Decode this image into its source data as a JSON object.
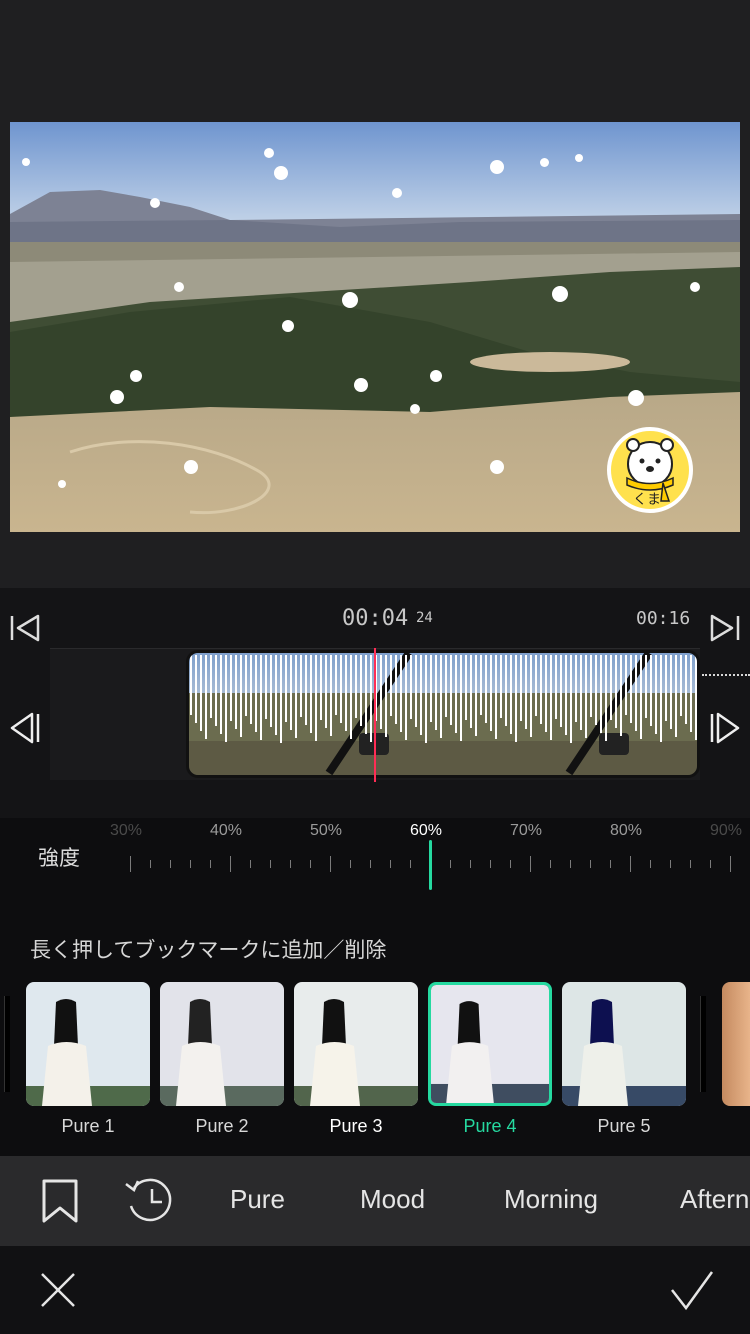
{
  "preview": {
    "mascot_label": "くま"
  },
  "timeline": {
    "current_time": "00:04",
    "current_frame": "24",
    "total_time": "00:16"
  },
  "intensity": {
    "label": "強度",
    "scale": [
      "30%",
      "40%",
      "50%",
      "60%",
      "70%",
      "80%",
      "90%"
    ],
    "selected": "60%",
    "value_percent": 60
  },
  "hint": "長く押してブックマークに追加／削除",
  "filters": [
    {
      "label": "Pure 1",
      "selected": false
    },
    {
      "label": "Pure 2",
      "selected": false
    },
    {
      "label": "Pure 3",
      "selected": false
    },
    {
      "label": "Pure 4",
      "selected": true
    },
    {
      "label": "Pure 5",
      "selected": false
    }
  ],
  "categories": [
    "Pure",
    "Mood",
    "Morning",
    "Aftern"
  ],
  "icons": {
    "bookmark": "bookmark-icon",
    "history": "history-icon",
    "cancel": "close-icon",
    "confirm": "check-icon",
    "skip_start": "skip-to-start-icon",
    "skip_end": "skip-to-end-icon",
    "prev_frame": "previous-frame-icon",
    "next_frame": "next-frame-icon"
  },
  "colors": {
    "accent": "#25d9a0",
    "playhead": "#ff2d55",
    "background": "#1c1c1e"
  }
}
